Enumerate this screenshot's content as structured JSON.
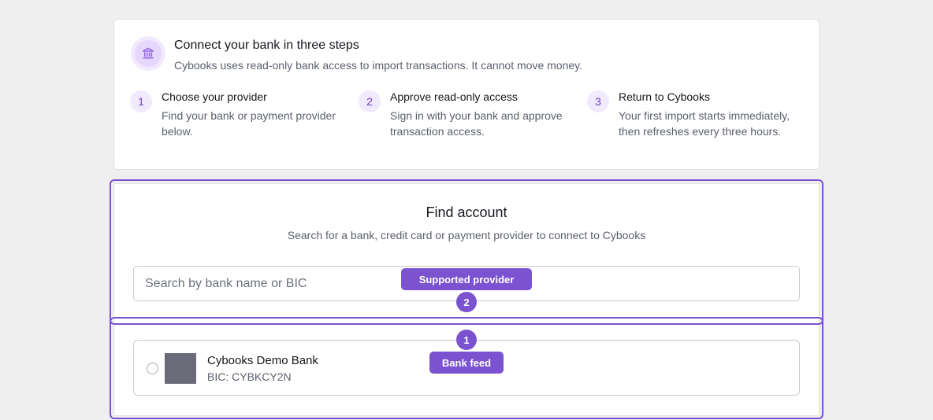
{
  "steps_card": {
    "title": "Connect your bank in three steps",
    "subtitle": "Cybooks uses read-only bank access to import transactions. It cannot move money.",
    "icon": "bank-icon",
    "steps": [
      {
        "number": "1",
        "title": "Choose your provider",
        "description": "Find your bank or payment provider below."
      },
      {
        "number": "2",
        "title": "Approve read-only access",
        "description": "Sign in with your bank and approve transaction access."
      },
      {
        "number": "3",
        "title": "Return to Cybooks",
        "description": "Your first import starts immediately, then refreshes every three hours."
      }
    ]
  },
  "find_account": {
    "title": "Find account",
    "subtitle": "Search for a bank, credit card or payment provider to connect to Cybooks",
    "search_placeholder": "Search by bank name or BIC",
    "search_value": ""
  },
  "results": [
    {
      "name": "Cybooks Demo Bank",
      "bic": "BIC: CYBKCY2N",
      "selected": false
    }
  ],
  "annotations": {
    "supported_provider_label": "Supported provider",
    "supported_provider_number": "2",
    "bank_feed_label": "Bank feed",
    "bank_feed_number": "1"
  },
  "colors": {
    "accent": "#7b52d0",
    "background": "#efefef",
    "card": "#ffffff"
  }
}
